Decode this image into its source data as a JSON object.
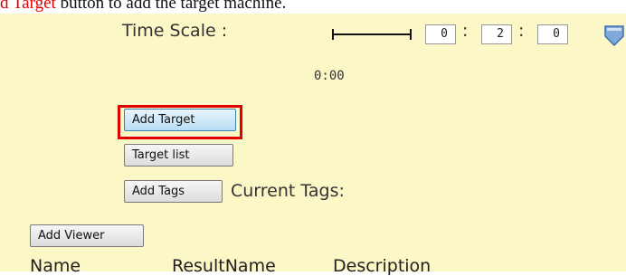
{
  "caption": {
    "highlight": "d Target",
    "rest": " button to add the target machine."
  },
  "time_scale": {
    "label": "Time Scale :",
    "hours": "0",
    "minutes": "2",
    "seconds": "0",
    "separator": ":"
  },
  "readout": {
    "time": "0:00"
  },
  "buttons": {
    "add_target": "Add Target",
    "target_list": "Target list",
    "add_tags": "Add Tags",
    "add_viewer": "Add Viewer"
  },
  "tags": {
    "label": "Current Tags:"
  },
  "table": {
    "columns": [
      "Name",
      "ResultName",
      "Description"
    ]
  },
  "colors": {
    "panel_bg": "#fbf7c6",
    "highlight_red": "#e00000",
    "focused_button": "#b9def5"
  },
  "icons": {
    "slider_handle": "slider-handle-icon"
  }
}
